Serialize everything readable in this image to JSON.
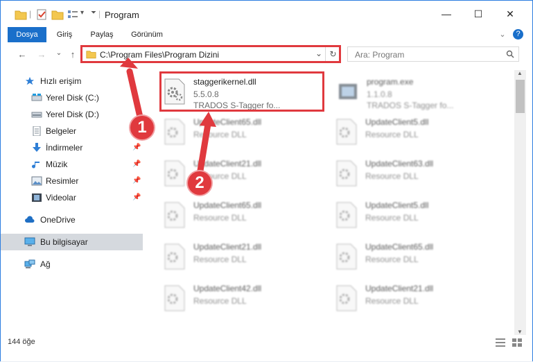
{
  "window": {
    "title": "Program",
    "minimize_glyph": "—",
    "maximize_glyph": "☐",
    "close_glyph": "✕"
  },
  "ribbon": {
    "tabs": [
      "Dosya",
      "Giriş",
      "Paylaş",
      "Görünüm"
    ],
    "help_glyph": "?",
    "expand_glyph": "⌄"
  },
  "nav": {
    "back_glyph": "←",
    "forward_glyph": "→",
    "recent_glyph": "⌄",
    "up_glyph": "↑",
    "address": "C:\\Program Files\\Program Dizini",
    "address_dropdown_glyph": "⌄",
    "refresh_glyph": "↻",
    "search_placeholder": "Ara: Program"
  },
  "sidebar": {
    "items": [
      {
        "label": "Hızlı erişim",
        "icon": "star-icon"
      },
      {
        "label": "Yerel Disk (C:)",
        "icon": "drive-icon"
      },
      {
        "label": "Yerel Disk (D:)",
        "icon": "drive-icon"
      },
      {
        "label": "Belgeler",
        "icon": "documents-icon"
      },
      {
        "label": "İndirmeler",
        "icon": "download-icon",
        "pinned": true
      },
      {
        "label": "Müzik",
        "icon": "music-icon",
        "pinned": true
      },
      {
        "label": "Resimler",
        "icon": "pictures-icon",
        "pinned": true
      },
      {
        "label": "Videolar",
        "icon": "videos-icon",
        "pinned": true
      },
      {
        "label": "OneDrive",
        "icon": "cloud-icon"
      },
      {
        "label": "Bu bilgisayar",
        "icon": "computer-icon"
      },
      {
        "label": "Ağ",
        "icon": "network-icon"
      }
    ]
  },
  "files": {
    "selected": {
      "name": "staggerikernel.dll",
      "version": "5.5.0.8",
      "description": "TRADOS S-Tagger  fo..."
    },
    "top_right": {
      "name": "program.exe",
      "version": "1.1.0.8",
      "description": "TRADOS S-Tagger  fo..."
    },
    "left_column": [
      {
        "name": "UpdateClient65.dll",
        "type": "Resource DLL"
      },
      {
        "name": "UpdateClient21.dll",
        "type": "Resource DLL"
      },
      {
        "name": "UpdateClient65.dll",
        "type": "Resource DLL"
      },
      {
        "name": "UpdateClient21.dll",
        "type": "Resource DLL"
      },
      {
        "name": "UpdateClient42.dll",
        "type": "Resource DLL"
      }
    ],
    "right_column": [
      {
        "name": "UpdateClient5.dll",
        "type": "Resource DLL"
      },
      {
        "name": "UpdateClient63.dll",
        "type": "Resource DLL"
      },
      {
        "name": "UpdateClient5.dll",
        "type": "Resource DLL"
      },
      {
        "name": "UpdateClient65.dll",
        "type": "Resource DLL"
      },
      {
        "name": "UpdateClient21.dll",
        "type": "Resource DLL"
      }
    ]
  },
  "status": {
    "count": "144 öğe"
  },
  "annotations": {
    "one": "1",
    "two": "2",
    "color": "#e0393e"
  }
}
